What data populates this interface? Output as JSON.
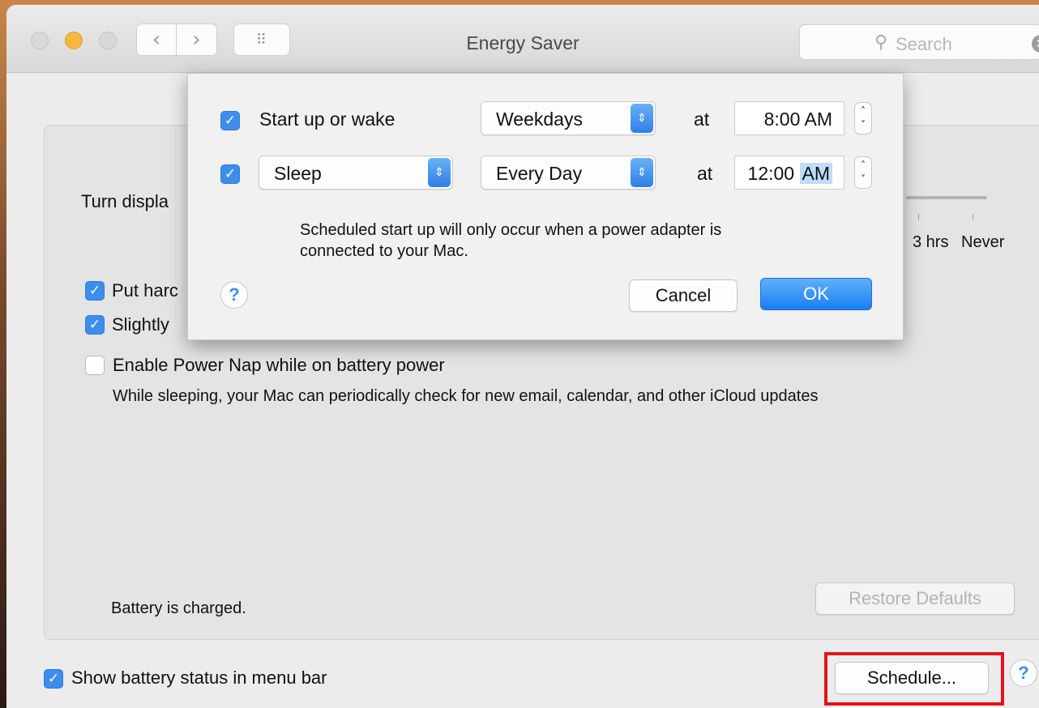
{
  "window": {
    "title": "Energy Saver",
    "nav": {
      "back_glyph": "‹",
      "forward_glyph": "›",
      "grid_glyph": "⠿"
    },
    "search": {
      "placeholder": "Search",
      "icon": "search-icon",
      "clear_glyph": "✕"
    }
  },
  "panel": {
    "turn_display_label": "Turn displa",
    "slider_labels": {
      "three_hrs": "3 hrs",
      "never": "Never"
    },
    "options": [
      {
        "label": "Put harc",
        "checked": true
      },
      {
        "label": "Slightly",
        "checked": true
      },
      {
        "label": "Enable Power Nap while on battery power",
        "checked": false
      }
    ],
    "power_nap_description": "While sleeping, your Mac can periodically check for new email, calendar, and other iCloud updates",
    "battery_status": "Battery is charged.",
    "restore_defaults": "Restore Defaults"
  },
  "footer": {
    "show_battery_label": "Show battery status in menu bar",
    "show_battery_checked": true,
    "schedule_button": "Schedule...",
    "help_glyph": "?"
  },
  "sheet": {
    "row1": {
      "checked": true,
      "label": "Start up or wake",
      "day_option": "Weekdays",
      "at": "at",
      "time_main": "8:00 AM"
    },
    "row2": {
      "checked": true,
      "action": "Sleep",
      "day_option": "Every Day",
      "at": "at",
      "time_main": "12:00 ",
      "time_ampm": "AM"
    },
    "note_line1": "Scheduled start up will only occur when a power adapter is",
    "note_line2": "connected to your Mac.",
    "help_glyph": "?",
    "cancel": "Cancel",
    "ok": "OK",
    "check_glyph": "✓",
    "popup_arrow_glyph": "⇕",
    "stepper_glyph_up": "˄",
    "stepper_glyph_down": "˅"
  },
  "colors": {
    "accent": "#3d8eea",
    "highlight_border": "#e3141b"
  }
}
